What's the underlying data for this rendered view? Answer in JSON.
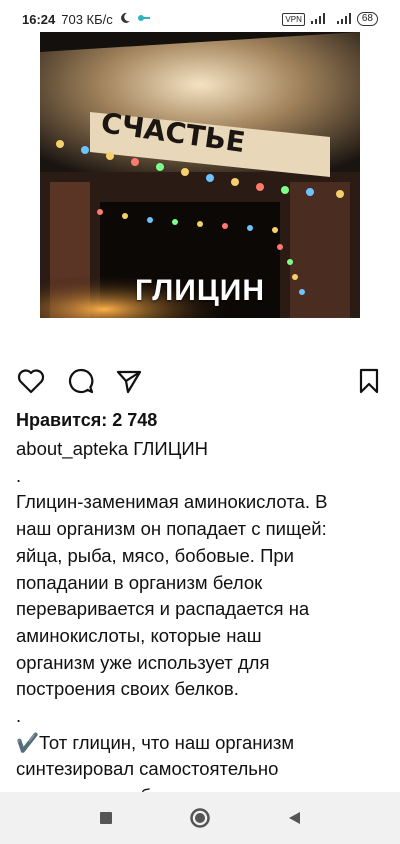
{
  "status_bar": {
    "time": "16:24",
    "speed": "703 КБ/с",
    "vpn": "VPN",
    "battery": "68"
  },
  "post": {
    "image_text": "ГЛИЦИН",
    "sign_text": "СЧАСТЬЕ",
    "likes_label": "Нравится: 2 748",
    "username": "about_apteka",
    "title": "ГЛИЦИН",
    "lines": [
      ".",
      "Глицин-заменимая аминокислота. В",
      "наш организм он попадает с пищей:",
      "яйца, рыба, мясо, бобовые. При",
      "попадании в организм белок",
      "переваривается и распадается на",
      "аминокислоты, которые наш",
      "организм уже использует для",
      "построения своих белков.",
      ".",
      "✔️Тот глицин, что наш организм",
      "синтезировал самостоятельно",
      "участвует в работе нашего головного"
    ]
  },
  "icons": {
    "like": "heart-icon",
    "comment": "comment-icon",
    "share": "send-icon",
    "save": "bookmark-icon"
  },
  "nav_bar": {
    "recent": "square-icon",
    "home": "circle-icon",
    "back": "triangle-icon"
  }
}
